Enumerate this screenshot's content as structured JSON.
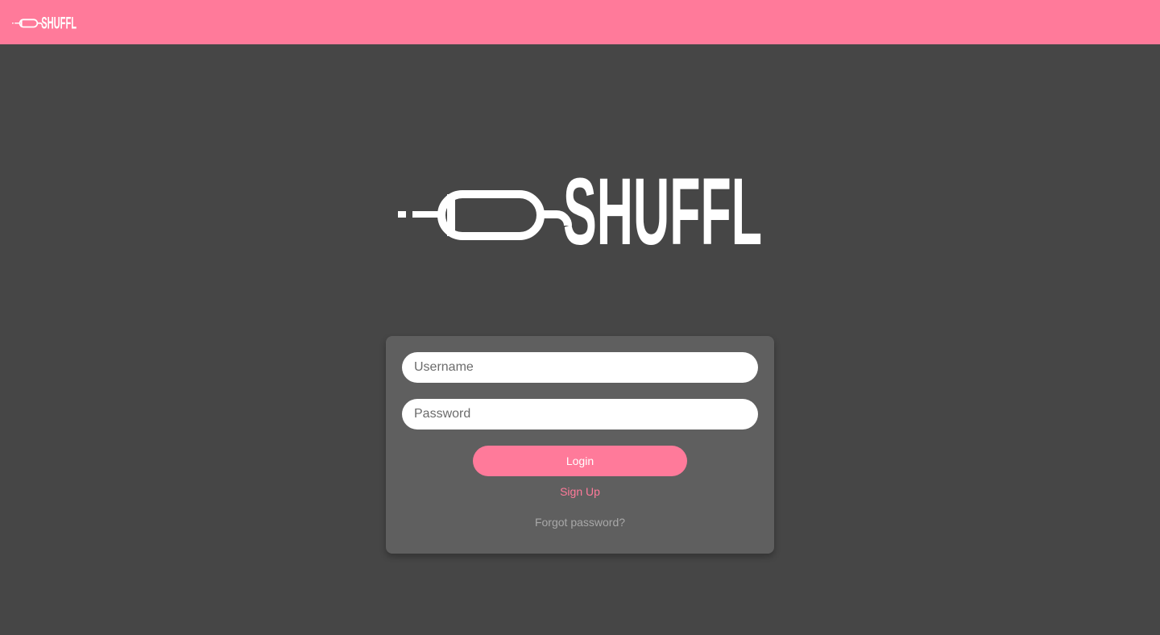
{
  "brand": {
    "name": "SHUFFL",
    "accent_color": "#ff7a9a",
    "logo_icon": "aux-cable-plug-icon"
  },
  "login": {
    "username_placeholder": "Username",
    "password_placeholder": "Password",
    "login_label": "Login",
    "signup_label": "Sign Up",
    "forgot_label": "Forgot password?"
  }
}
